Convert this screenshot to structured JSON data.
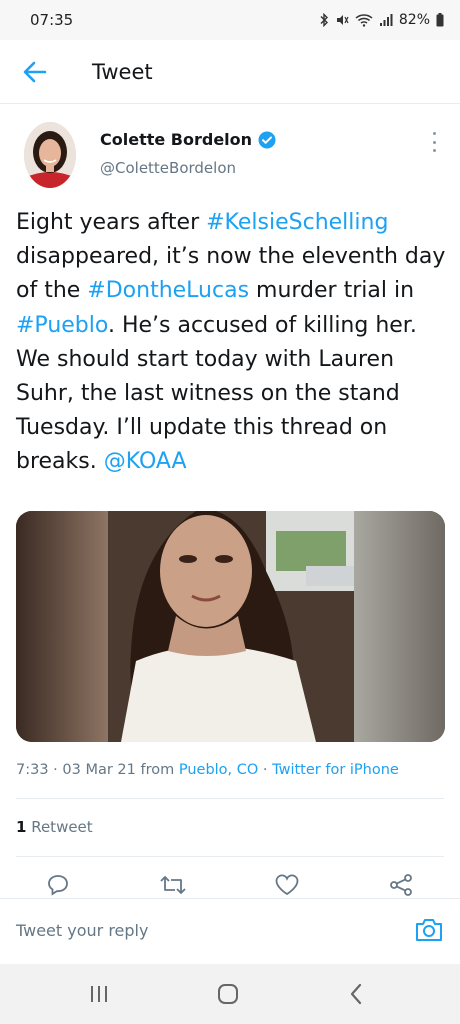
{
  "status_bar": {
    "time": "07:35",
    "battery": "82%"
  },
  "header": {
    "title": "Tweet"
  },
  "author": {
    "name": "Colette Bordelon",
    "handle": "@ColetteBordelon"
  },
  "tweet": {
    "segments": [
      {
        "text": "Eight years after ",
        "link": false
      },
      {
        "text": "#KelsieSchelling",
        "link": true
      },
      {
        "text": " disappeared, it’s now the eleventh day of the ",
        "link": false
      },
      {
        "text": "#DontheLucas",
        "link": true
      },
      {
        "text": " murder trial in ",
        "link": false
      },
      {
        "text": "#Pueblo",
        "link": true
      },
      {
        "text": ". He’s accused of killing her. We should start today with Lauren Suhr, the last witness on the stand Tuesday. I’ll update this thread on breaks. ",
        "link": false
      },
      {
        "text": "@KOAA",
        "link": true
      }
    ]
  },
  "meta": {
    "time": "7:33",
    "dot": " · ",
    "date": "03 Mar 21",
    "from": " from ",
    "location": "Pueblo, CO",
    "source": "Twitter for iPhone"
  },
  "stats": {
    "retweet_count": "1",
    "retweet_label": " Retweet"
  },
  "reply": {
    "placeholder": "Tweet your reply"
  },
  "colors": {
    "accent": "#1da1f2",
    "text": "#14171a",
    "secondary": "#657786",
    "verified": "#1da1f2"
  },
  "icons": {
    "back": "arrow-left-icon",
    "verified": "verified-badge-icon",
    "more": "more-vertical-icon",
    "reply": "comment-icon",
    "retweet": "retweet-icon",
    "like": "heart-icon",
    "share": "share-icon",
    "camera": "camera-icon"
  }
}
